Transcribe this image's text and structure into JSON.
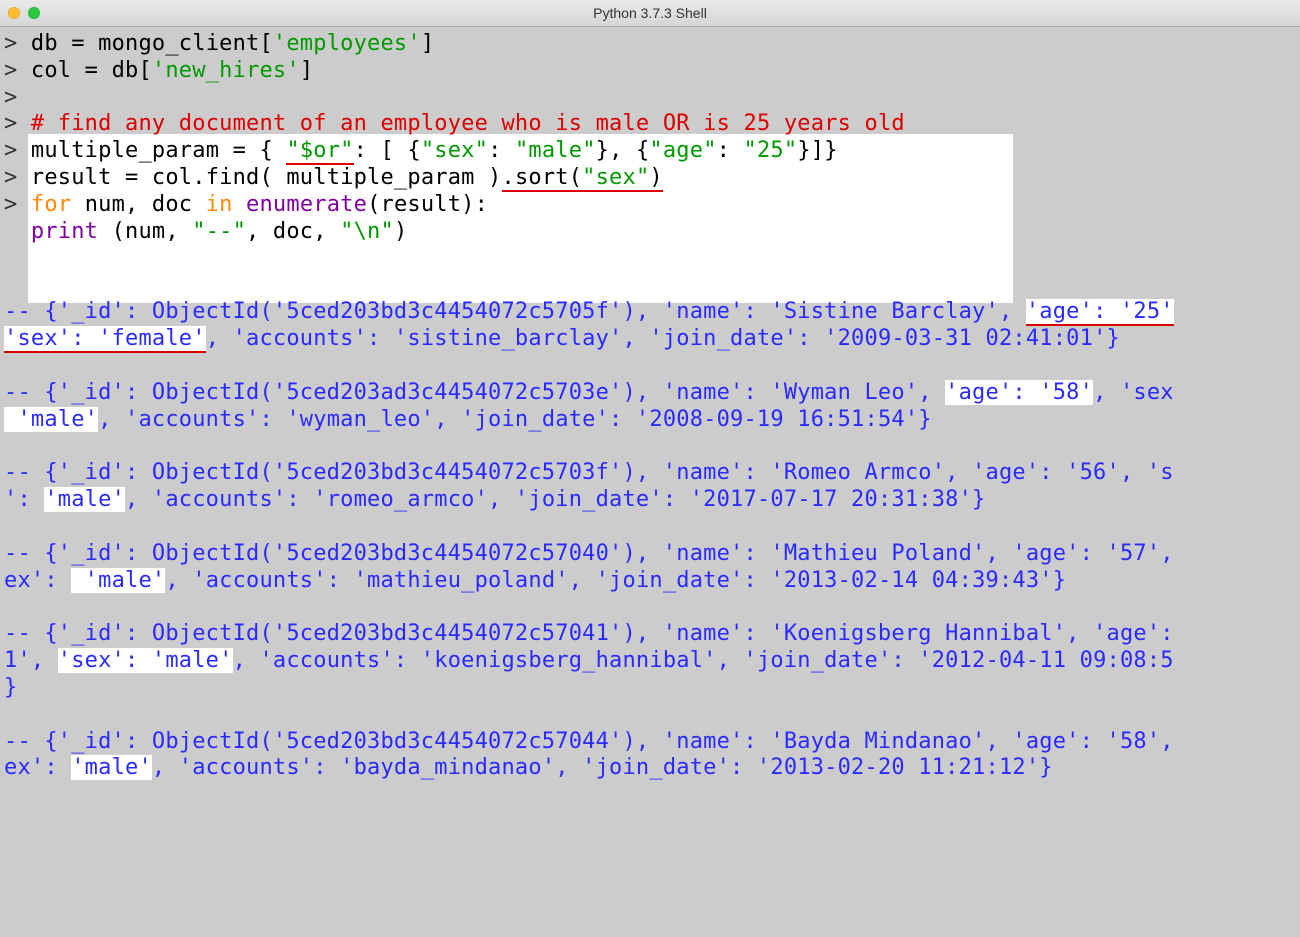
{
  "window": {
    "title": "Python 3.7.3 Shell"
  },
  "prompt": ">",
  "code": {
    "l1_a": "db = mongo_client[",
    "l1_s": "'employees'",
    "l1_b": "]",
    "l2_a": "col = db[",
    "l2_s": "'new_hires'",
    "l2_b": "]",
    "comment": "# find any document of an employee who is male OR is 25 years old",
    "l4_a": "multiple_param = { ",
    "l4_or": "\"$or\"",
    "l4_b": ": [ {",
    "l4_sex": "\"sex\"",
    "l4_c": ": ",
    "l4_male": "\"male\"",
    "l4_d": "}, {",
    "l4_age": "\"age\"",
    "l4_e": ": ",
    "l4_25": "\"25\"",
    "l4_f": "}]}",
    "l5_a": "result = col.find( multiple_param )",
    "l5_sort": ".sort(",
    "l5_sexstr": "\"sex\"",
    "l5_close": ")",
    "l6_for": "for",
    "l6_a": " num, doc ",
    "l6_in": "in",
    "l6_b": " ",
    "l6_enum": "enumerate",
    "l6_c": "(result):",
    "l7_print": "print",
    "l7_a": " (num, ",
    "l7_dd": "\"--\"",
    "l7_b": ", doc, ",
    "l7_nl": "\"\\n\"",
    "l7_c": ")"
  },
  "out": {
    "r0_a": "-- {'_id': ObjectId('5ced203bd3c4454072c5705f'), 'name': 'Sistine Barclay', ",
    "r0_age": "'age': '25'",
    "r0_wrap_a": "'sex': 'female'",
    "r0_wrap_b": ", 'accounts': 'sistine_barclay', 'join_date': '2009-03-31 02:41:01'}",
    "r1_a": "-- {'_id': ObjectId('5ced203ad3c4454072c5703e'), 'name': 'Wyman Leo', ",
    "r1_age": "'age': '58'",
    "r1_b": ", 'sex",
    "r1_wrap_a": " 'male'",
    "r1_wrap_b": ", 'accounts': 'wyman_leo', 'join_date': '2008-09-19 16:51:54'}",
    "r2_a": "-- {'_id': ObjectId('5ced203bd3c4454072c5703f'), 'name': 'Romeo Armco', 'age': '56', 's",
    "r2_wrap_a": "': ",
    "r2_male": "'male'",
    "r2_wrap_b": ", 'accounts': 'romeo_armco', 'join_date': '2017-07-17 20:31:38'}",
    "r3_a": "-- {'_id': ObjectId('5ced203bd3c4454072c57040'), 'name': 'Mathieu Poland', 'age': '57',",
    "r3_wrap_a": "ex': ",
    "r3_male": " 'male'",
    "r3_wrap_b": ", 'accounts': 'mathieu_poland', 'join_date': '2013-02-14 04:39:43'}",
    "r4_a": "-- {'_id': ObjectId('5ced203bd3c4454072c57041'), 'name': 'Koenigsberg Hannibal', 'age':",
    "r4_wrap_a": "1', ",
    "r4_sex": "'sex': 'male'",
    "r4_wrap_b": ", 'accounts': 'koenigsberg_hannibal', 'join_date': '2012-04-11 09:08:5",
    "r4_wrap_c": "}",
    "r5_a": "-- {'_id': ObjectId('5ced203bd3c4454072c57044'), 'name': 'Bayda Mindanao', 'age': '58',",
    "r5_wrap_a": "ex': ",
    "r5_male": "'male'",
    "r5_wrap_b": ", 'accounts': 'bayda_mindanao', 'join_date': '2013-02-20 11:21:12'}"
  }
}
